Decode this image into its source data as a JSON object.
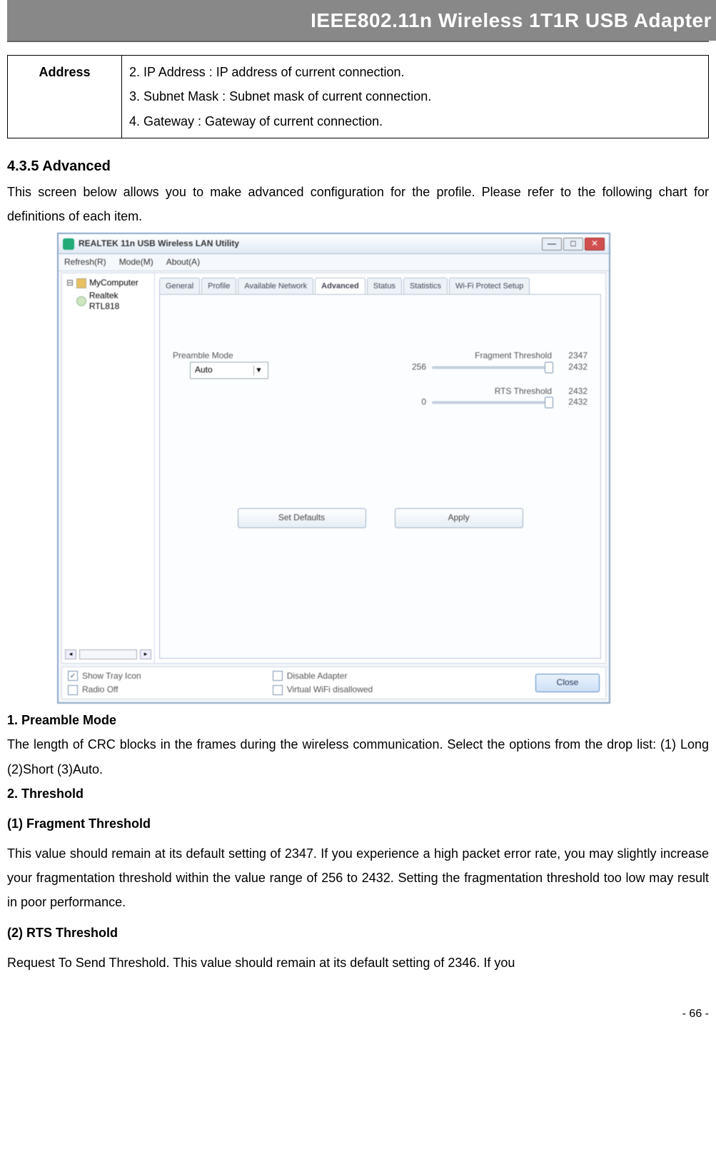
{
  "header": {
    "title": "IEEE802.11n Wireless 1T1R USB Adapter"
  },
  "table": {
    "header": "Address",
    "lines": [
      "2. IP Address : IP address of current connection.",
      "3. Subnet Mask : Subnet mask of current connection.",
      "4. Gateway : Gateway of current connection."
    ]
  },
  "section": {
    "num_title": "4.3.5    Advanced",
    "intro": "This screen below allows you to make advanced configuration for the profile. Please refer to the following chart for definitions of each item."
  },
  "app": {
    "title": "REALTEK 11n USB Wireless LAN Utility",
    "menu": [
      "Refresh(R)",
      "Mode(M)",
      "About(A)"
    ],
    "tree": {
      "root": "MyComputer",
      "child": "Realtek RTL818"
    },
    "tabs": [
      "General",
      "Profile",
      "Available Network",
      "Advanced",
      "Status",
      "Statistics",
      "Wi-Fi Protect Setup"
    ],
    "preamble_label": "Preamble Mode",
    "preamble_value": "Auto",
    "frag_label": "Fragment Threshold",
    "frag_value": "2347",
    "frag_min": "256",
    "frag_max": "2432",
    "rts_label": "RTS Threshold",
    "rts_value": "2432",
    "rts_min": "0",
    "rts_max": "2432",
    "btn_defaults": "Set Defaults",
    "btn_apply": "Apply",
    "chk_tray": "Show Tray Icon",
    "chk_radio": "Radio Off",
    "chk_disable": "Disable Adapter",
    "chk_vwifi": "Virtual WiFi disallowed",
    "btn_close": "Close"
  },
  "body": {
    "h1": "1. Preamble Mode",
    "p1": "The length of CRC blocks in the frames during the wireless communication. Select the options from the drop list: (1) Long    (2)Short    (3)Auto.",
    "h2": "2. Threshold",
    "h3": "(1) Fragment Threshold",
    "p3": "This value should remain at its default setting of 2347. If you experience a high packet error rate, you may slightly increase your fragmentation threshold within the value range of 256 to 2432. Setting the fragmentation threshold too low may result in poor performance.",
    "h4": "(2) RTS Threshold",
    "p4": "Request To Send Threshold. This value should remain at its default setting of 2346. If you"
  },
  "page": "- 66 -"
}
